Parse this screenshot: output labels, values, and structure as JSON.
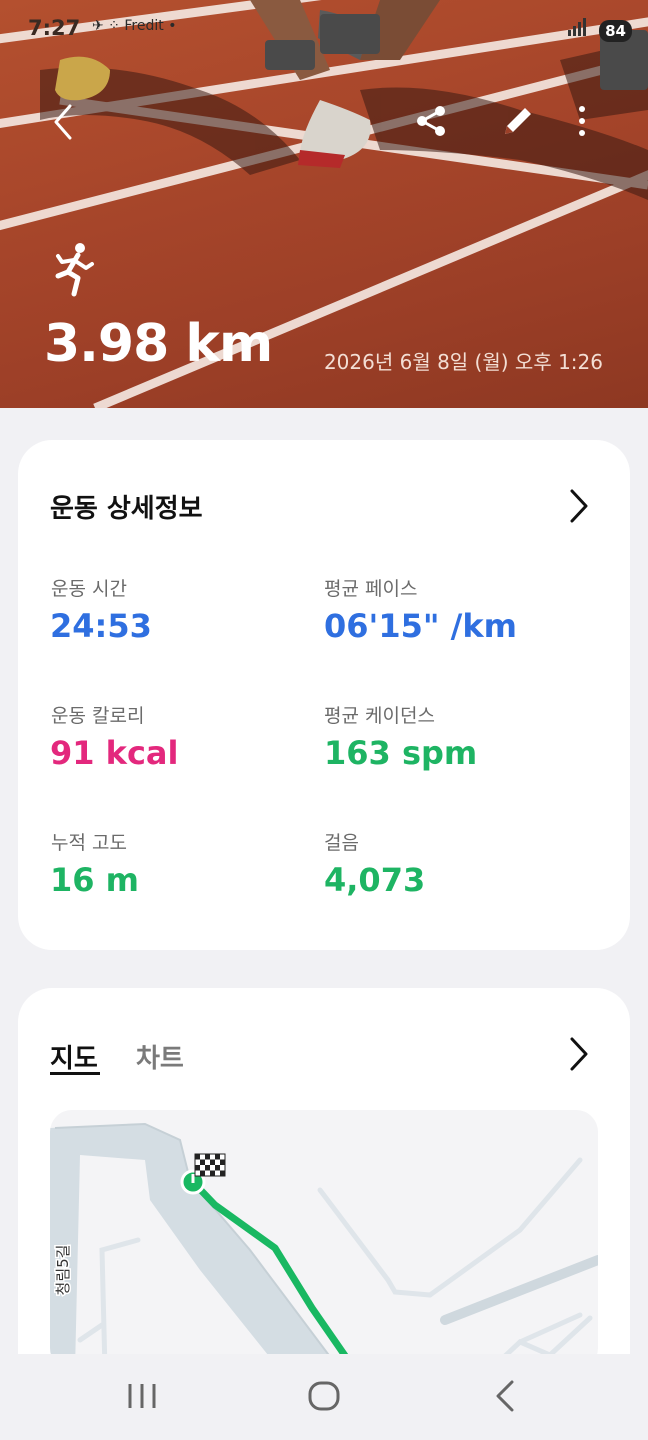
{
  "status_bar": {
    "time": "7:27",
    "notif_text": "Fredit",
    "battery": "84"
  },
  "hero": {
    "distance": "3.98 km",
    "datetime": "2026년 6월 8일 (월) 오후 1:26",
    "activity_icon": "running-icon",
    "actions": [
      "back-icon",
      "share-icon",
      "edit-icon",
      "more-icon"
    ]
  },
  "details": {
    "title": "운동 상세정보",
    "stats": [
      {
        "label": "운동 시간",
        "value": "24:53",
        "color": "#2f6fe0"
      },
      {
        "label": "평균 페이스",
        "value": "06'15\" /km",
        "color": "#2f6fe0"
      },
      {
        "label": "운동 칼로리",
        "value": "91 kcal",
        "color": "#e3287d"
      },
      {
        "label": "평균 케이던스",
        "value": "163 spm",
        "color": "#1eb463"
      },
      {
        "label": "누적 고도",
        "value": "16 m",
        "color": "#1eb463"
      },
      {
        "label": "걸음",
        "value": "4,073",
        "color": "#1eb463"
      }
    ]
  },
  "map_card": {
    "tabs": [
      {
        "label": "지도",
        "active": true
      },
      {
        "label": "차트",
        "active": false
      }
    ],
    "street_label": "청림5길",
    "route_color": "#19b862"
  },
  "nav": [
    "recents-icon",
    "home-icon",
    "back-nav-icon"
  ]
}
